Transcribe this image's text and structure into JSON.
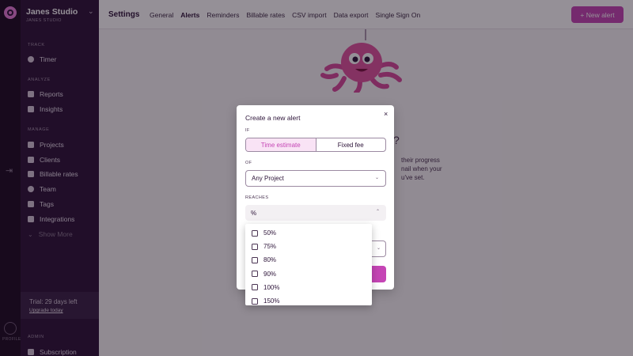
{
  "workspace": {
    "name": "Janes Studio",
    "subtitle": "JANES STUDIO"
  },
  "rail": {
    "profile_label": "PROFILE"
  },
  "sidebar": {
    "sections": [
      {
        "label": "TRACK",
        "items": [
          {
            "label": "Timer",
            "icon": "clock-icon"
          }
        ]
      },
      {
        "label": "ANALYZE",
        "items": [
          {
            "label": "Reports",
            "icon": "report-icon"
          },
          {
            "label": "Insights",
            "icon": "insights-icon"
          }
        ]
      },
      {
        "label": "MANAGE",
        "items": [
          {
            "label": "Projects",
            "icon": "folder-icon"
          },
          {
            "label": "Clients",
            "icon": "client-icon"
          },
          {
            "label": "Billable rates",
            "icon": "dollar-icon"
          },
          {
            "label": "Team",
            "icon": "team-icon"
          },
          {
            "label": "Tags",
            "icon": "tag-icon"
          },
          {
            "label": "Integrations",
            "icon": "puzzle-icon"
          }
        ]
      }
    ],
    "show_more": "Show More",
    "trial": {
      "text": "Trial: 29 days left",
      "link": "Upgrade today"
    },
    "admin": {
      "label": "ADMIN",
      "item": "Subscription"
    }
  },
  "topbar": {
    "title": "Settings",
    "tabs": [
      "General",
      "Alerts",
      "Reminders",
      "Billable rates",
      "CSV import",
      "Data export",
      "Single Sign On"
    ],
    "active_tab": "Alerts",
    "new_alert": "+ New alert"
  },
  "background_text": {
    "q_mark": "?",
    "line1": "their progress",
    "line2": "nail when your",
    "line3": "u've set."
  },
  "modal": {
    "title": "Create a new alert",
    "close": "×",
    "if_label": "IF",
    "segment": {
      "options": [
        "Time estimate",
        "Fixed fee"
      ],
      "selected": "Time estimate"
    },
    "of_label": "OF",
    "project_select": "Any Project",
    "reaches_label": "REACHES",
    "reaches_value": "%"
  },
  "dropdown": {
    "options": [
      "50%",
      "75%",
      "80%",
      "90%",
      "100%",
      "150%"
    ]
  },
  "colors": {
    "brand": "#c545b5",
    "sidebar": "#2c1338",
    "rail": "#1c0b22"
  }
}
